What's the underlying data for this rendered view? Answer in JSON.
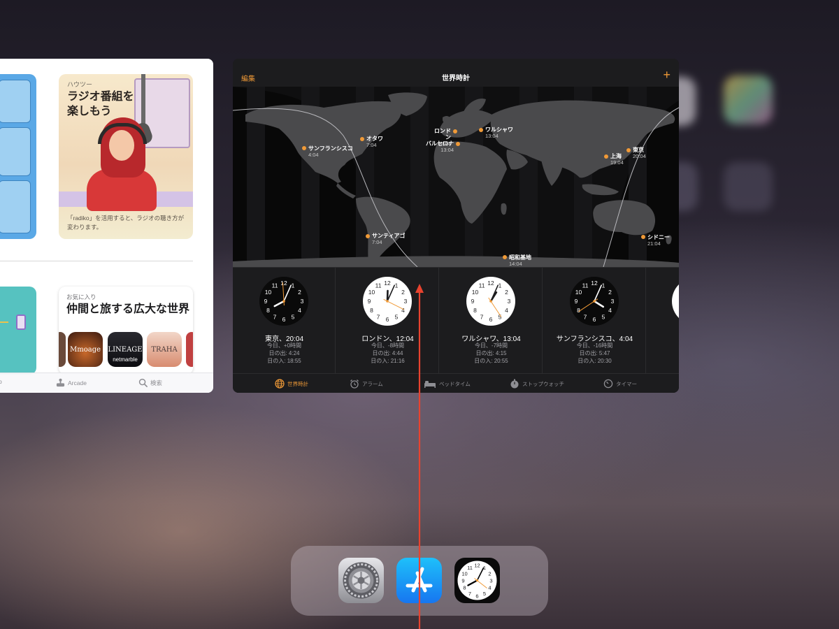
{
  "app_store": {
    "feature_card": {
      "eyebrow": "ハウツー",
      "title": "ラジオ番組を楽しもう",
      "subtitle": "「radiko」を活用すると、ラジオの聴き方が変わります。"
    },
    "second_card": {
      "eyebrow": "お気に入り",
      "title": "仲間と旅する広大な世界",
      "icons": [
        {
          "icon": "game-icon-partial",
          "label": ""
        },
        {
          "icon": "mmorpg-icon",
          "label": "Mmoage"
        },
        {
          "icon": "lineage-revolution-icon",
          "label": "LINEAGE",
          "sub": "netmarble"
        },
        {
          "icon": "traha-icon",
          "label": "TRAHA"
        },
        {
          "icon": "game-icon-partial-right",
          "label": ""
        }
      ]
    },
    "tabbar": [
      {
        "label": "p",
        "icon": "apps-icon"
      },
      {
        "label": "Arcade",
        "icon": "arcade-icon"
      },
      {
        "label": "検索",
        "icon": "search-icon"
      }
    ]
  },
  "world_clock": {
    "nav": {
      "edit": "編集",
      "title": "世界時計",
      "add": "+"
    },
    "map_cities": [
      {
        "name": "サンフランシスコ",
        "time": "4:04"
      },
      {
        "name": "オタワ",
        "time": "7:04"
      },
      {
        "name": "ロンドン",
        "time": "12:04"
      },
      {
        "name": "バルセロナ",
        "time": "13:04"
      },
      {
        "name": "ワルシャワ",
        "time": "13:04"
      },
      {
        "name": "上海",
        "time": "19:04"
      },
      {
        "name": "東京",
        "time": "20:04"
      },
      {
        "name": "サンティアゴ",
        "time": "7:04"
      },
      {
        "name": "昭和基地",
        "time": "14:04"
      },
      {
        "name": "シドニー",
        "time": "21:04"
      }
    ],
    "clocks": [
      {
        "name": "東京、20:04",
        "offset": "今日、+0時間",
        "sunrise": "日の出: 4:24",
        "sunset": "日の入: 18:55",
        "face": "dark",
        "hour": 8,
        "minute": 4
      },
      {
        "name": "ロンドン、12:04",
        "offset": "今日、-8時間",
        "sunrise": "日の出: 4:44",
        "sunset": "日の入: 21:16",
        "face": "light",
        "hour": 12,
        "minute": 4
      },
      {
        "name": "ワルシャワ、13:04",
        "offset": "今日、-7時間",
        "sunrise": "日の出: 4:15",
        "sunset": "日の入: 20:55",
        "face": "light",
        "hour": 1,
        "minute": 4
      },
      {
        "name": "サンフランシスコ、4:04",
        "offset": "今日、-16時間",
        "sunrise": "日の出: 5:47",
        "sunset": "日の入: 20:30",
        "face": "dark",
        "hour": 4,
        "minute": 4
      }
    ],
    "tabs": [
      {
        "label": "世界時計",
        "icon": "globe-icon",
        "active": true
      },
      {
        "label": "アラーム",
        "icon": "alarm-icon",
        "active": false
      },
      {
        "label": "ベッドタイム",
        "icon": "bed-icon",
        "active": false
      },
      {
        "label": "ストップウォッチ",
        "icon": "stopwatch-icon",
        "active": false
      },
      {
        "label": "タイマー",
        "icon": "timer-icon",
        "active": false
      }
    ]
  },
  "dock": {
    "apps": [
      {
        "name": "Settings",
        "icon": "settings-icon"
      },
      {
        "name": "App Store",
        "icon": "app-store-icon"
      },
      {
        "name": "Clock",
        "icon": "clock-icon"
      }
    ]
  },
  "colors": {
    "accent": "#f09a37",
    "arrow": "#e8432f",
    "appstore_blue": "#1776f0"
  }
}
